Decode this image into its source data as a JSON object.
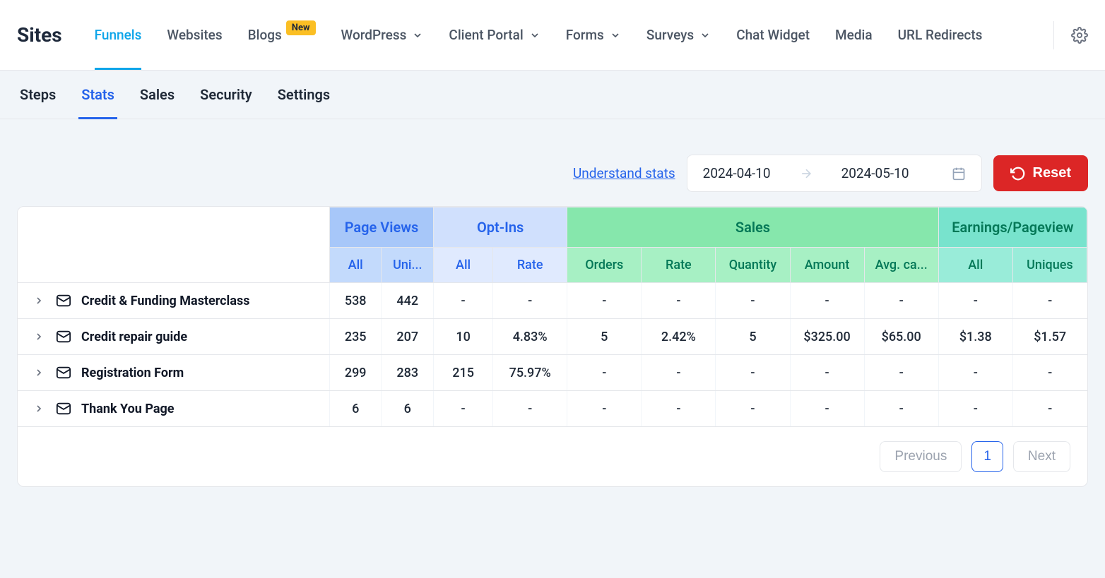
{
  "brand": "Sites",
  "topnav": [
    {
      "label": "Funnels",
      "active": true,
      "dropdown": false,
      "badge": null
    },
    {
      "label": "Websites",
      "active": false,
      "dropdown": false,
      "badge": null
    },
    {
      "label": "Blogs",
      "active": false,
      "dropdown": false,
      "badge": "New"
    },
    {
      "label": "WordPress",
      "active": false,
      "dropdown": true,
      "badge": null
    },
    {
      "label": "Client Portal",
      "active": false,
      "dropdown": true,
      "badge": null
    },
    {
      "label": "Forms",
      "active": false,
      "dropdown": true,
      "badge": null
    },
    {
      "label": "Surveys",
      "active": false,
      "dropdown": true,
      "badge": null
    },
    {
      "label": "Chat Widget",
      "active": false,
      "dropdown": false,
      "badge": null
    },
    {
      "label": "Media",
      "active": false,
      "dropdown": false,
      "badge": null
    },
    {
      "label": "URL Redirects",
      "active": false,
      "dropdown": false,
      "badge": null
    }
  ],
  "subtabs": [
    {
      "label": "Steps",
      "active": false
    },
    {
      "label": "Stats",
      "active": true
    },
    {
      "label": "Sales",
      "active": false
    },
    {
      "label": "Security",
      "active": false
    },
    {
      "label": "Settings",
      "active": false
    }
  ],
  "understand_label": "Understand stats",
  "date_start": "2024-04-10",
  "date_end": "2024-05-10",
  "reset_label": "Reset",
  "headers": {
    "page_views": "Page Views",
    "opt_ins": "Opt-Ins",
    "sales": "Sales",
    "earnings": "Earnings/Pageview",
    "pv_all": "All",
    "pv_uniques": "Uni...",
    "oi_all": "All",
    "oi_rate": "Rate",
    "s_orders": "Orders",
    "s_rate": "Rate",
    "s_quantity": "Quantity",
    "s_amount": "Amount",
    "s_avg": "Avg. ca...",
    "ep_all": "All",
    "ep_uniques": "Uniques"
  },
  "rows": [
    {
      "name": "Credit & Funding Masterclass",
      "pv_all": "538",
      "pv_uni": "442",
      "oi_all": "-",
      "oi_rate": "-",
      "orders": "-",
      "s_rate": "-",
      "qty": "-",
      "amount": "-",
      "avg": "-",
      "ep_all": "-",
      "ep_uni": "-"
    },
    {
      "name": "Credit repair guide",
      "pv_all": "235",
      "pv_uni": "207",
      "oi_all": "10",
      "oi_rate": "4.83%",
      "orders": "5",
      "s_rate": "2.42%",
      "qty": "5",
      "amount": "$325.00",
      "avg": "$65.00",
      "ep_all": "$1.38",
      "ep_uni": "$1.57"
    },
    {
      "name": "Registration Form",
      "pv_all": "299",
      "pv_uni": "283",
      "oi_all": "215",
      "oi_rate": "75.97%",
      "orders": "-",
      "s_rate": "-",
      "qty": "-",
      "amount": "-",
      "avg": "-",
      "ep_all": "-",
      "ep_uni": "-"
    },
    {
      "name": "Thank You Page",
      "pv_all": "6",
      "pv_uni": "6",
      "oi_all": "-",
      "oi_rate": "-",
      "orders": "-",
      "s_rate": "-",
      "qty": "-",
      "amount": "-",
      "avg": "-",
      "ep_all": "-",
      "ep_uni": "-"
    }
  ],
  "pagination": {
    "previous": "Previous",
    "page": "1",
    "next": "Next"
  }
}
